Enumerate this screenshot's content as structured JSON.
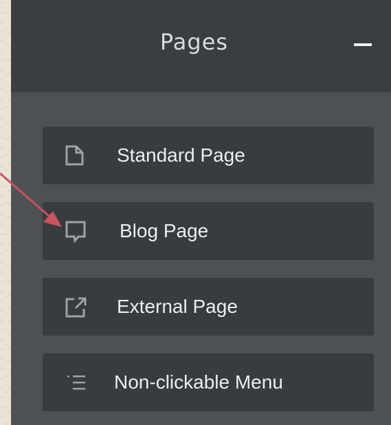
{
  "panel": {
    "title": "Pages",
    "collapse_icon": "minus-icon"
  },
  "items": [
    {
      "label": "Standard Page",
      "icon": "page-icon"
    },
    {
      "label": "Blog Page",
      "icon": "speech-bubble-icon"
    },
    {
      "label": "External Page",
      "icon": "external-link-icon"
    },
    {
      "label": "Non-clickable Menu",
      "icon": "list-icon"
    }
  ],
  "colors": {
    "background": "#e9e4d6",
    "panel": "#4d5154",
    "header": "#3a3e41",
    "item": "#383c3f",
    "text": "#eceeef",
    "icon": "#9ea2a5",
    "arrow": "#c8545f"
  },
  "annotation": {
    "arrow_icon": "arrow-icon"
  }
}
